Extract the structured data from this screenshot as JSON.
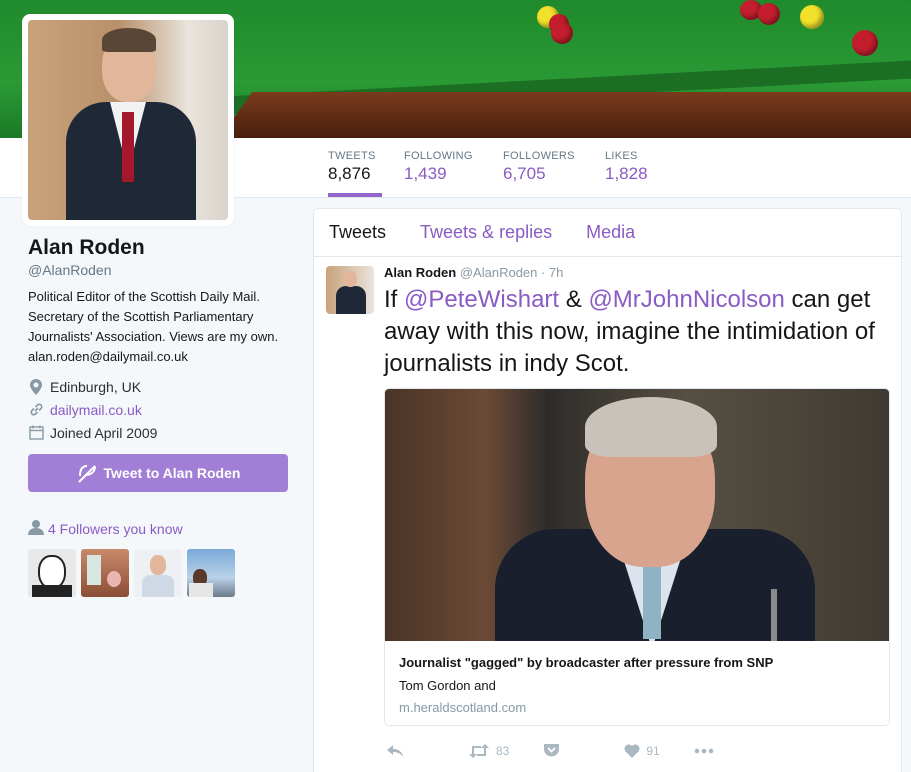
{
  "profile": {
    "name": "Alan Roden",
    "handle": "@AlanRoden",
    "bio": "Political Editor of the Scottish Daily Mail. Secretary of the Scottish Parliamentary Journalists' Association. Views are my own. alan.roden@dailymail.co.uk",
    "location": "Edinburgh, UK",
    "website": "dailymail.co.uk",
    "joined": "Joined April 2009",
    "tweet_to_label": "Tweet to Alan Roden",
    "followers_you_know": "4 Followers you know"
  },
  "stats": [
    {
      "label": "TWEETS",
      "value": "8,876"
    },
    {
      "label": "FOLLOWING",
      "value": "1,439"
    },
    {
      "label": "FOLLOWERS",
      "value": "6,705"
    },
    {
      "label": "LIKES",
      "value": "1,828"
    }
  ],
  "tabs": [
    "Tweets",
    "Tweets & replies",
    "Media"
  ],
  "tweet": {
    "name": "Alan Roden",
    "handle_time": "@AlanRoden · 7h",
    "text_pre": "If ",
    "mention1": "@PeteWishart",
    "text_mid": " & ",
    "mention2": "@MrJohnNicolson",
    "text_post": " can get away with this now, imagine the intimidation of journalists in indy Scot.",
    "card_title": "Journalist \"gagged\" by broadcaster after pressure from SNP",
    "card_desc": "Tom Gordon and",
    "card_url": "m.heraldscotland.com",
    "retweets": "83",
    "likes": "91"
  },
  "colors": {
    "accent": "#8a5bc4",
    "button": "#a17fd6"
  },
  "icons": [
    "location-icon",
    "link-icon",
    "calendar-icon",
    "compose-icon",
    "person-icon",
    "reply-icon",
    "retweet-icon",
    "pocket-icon",
    "heart-icon",
    "more-icon"
  ]
}
